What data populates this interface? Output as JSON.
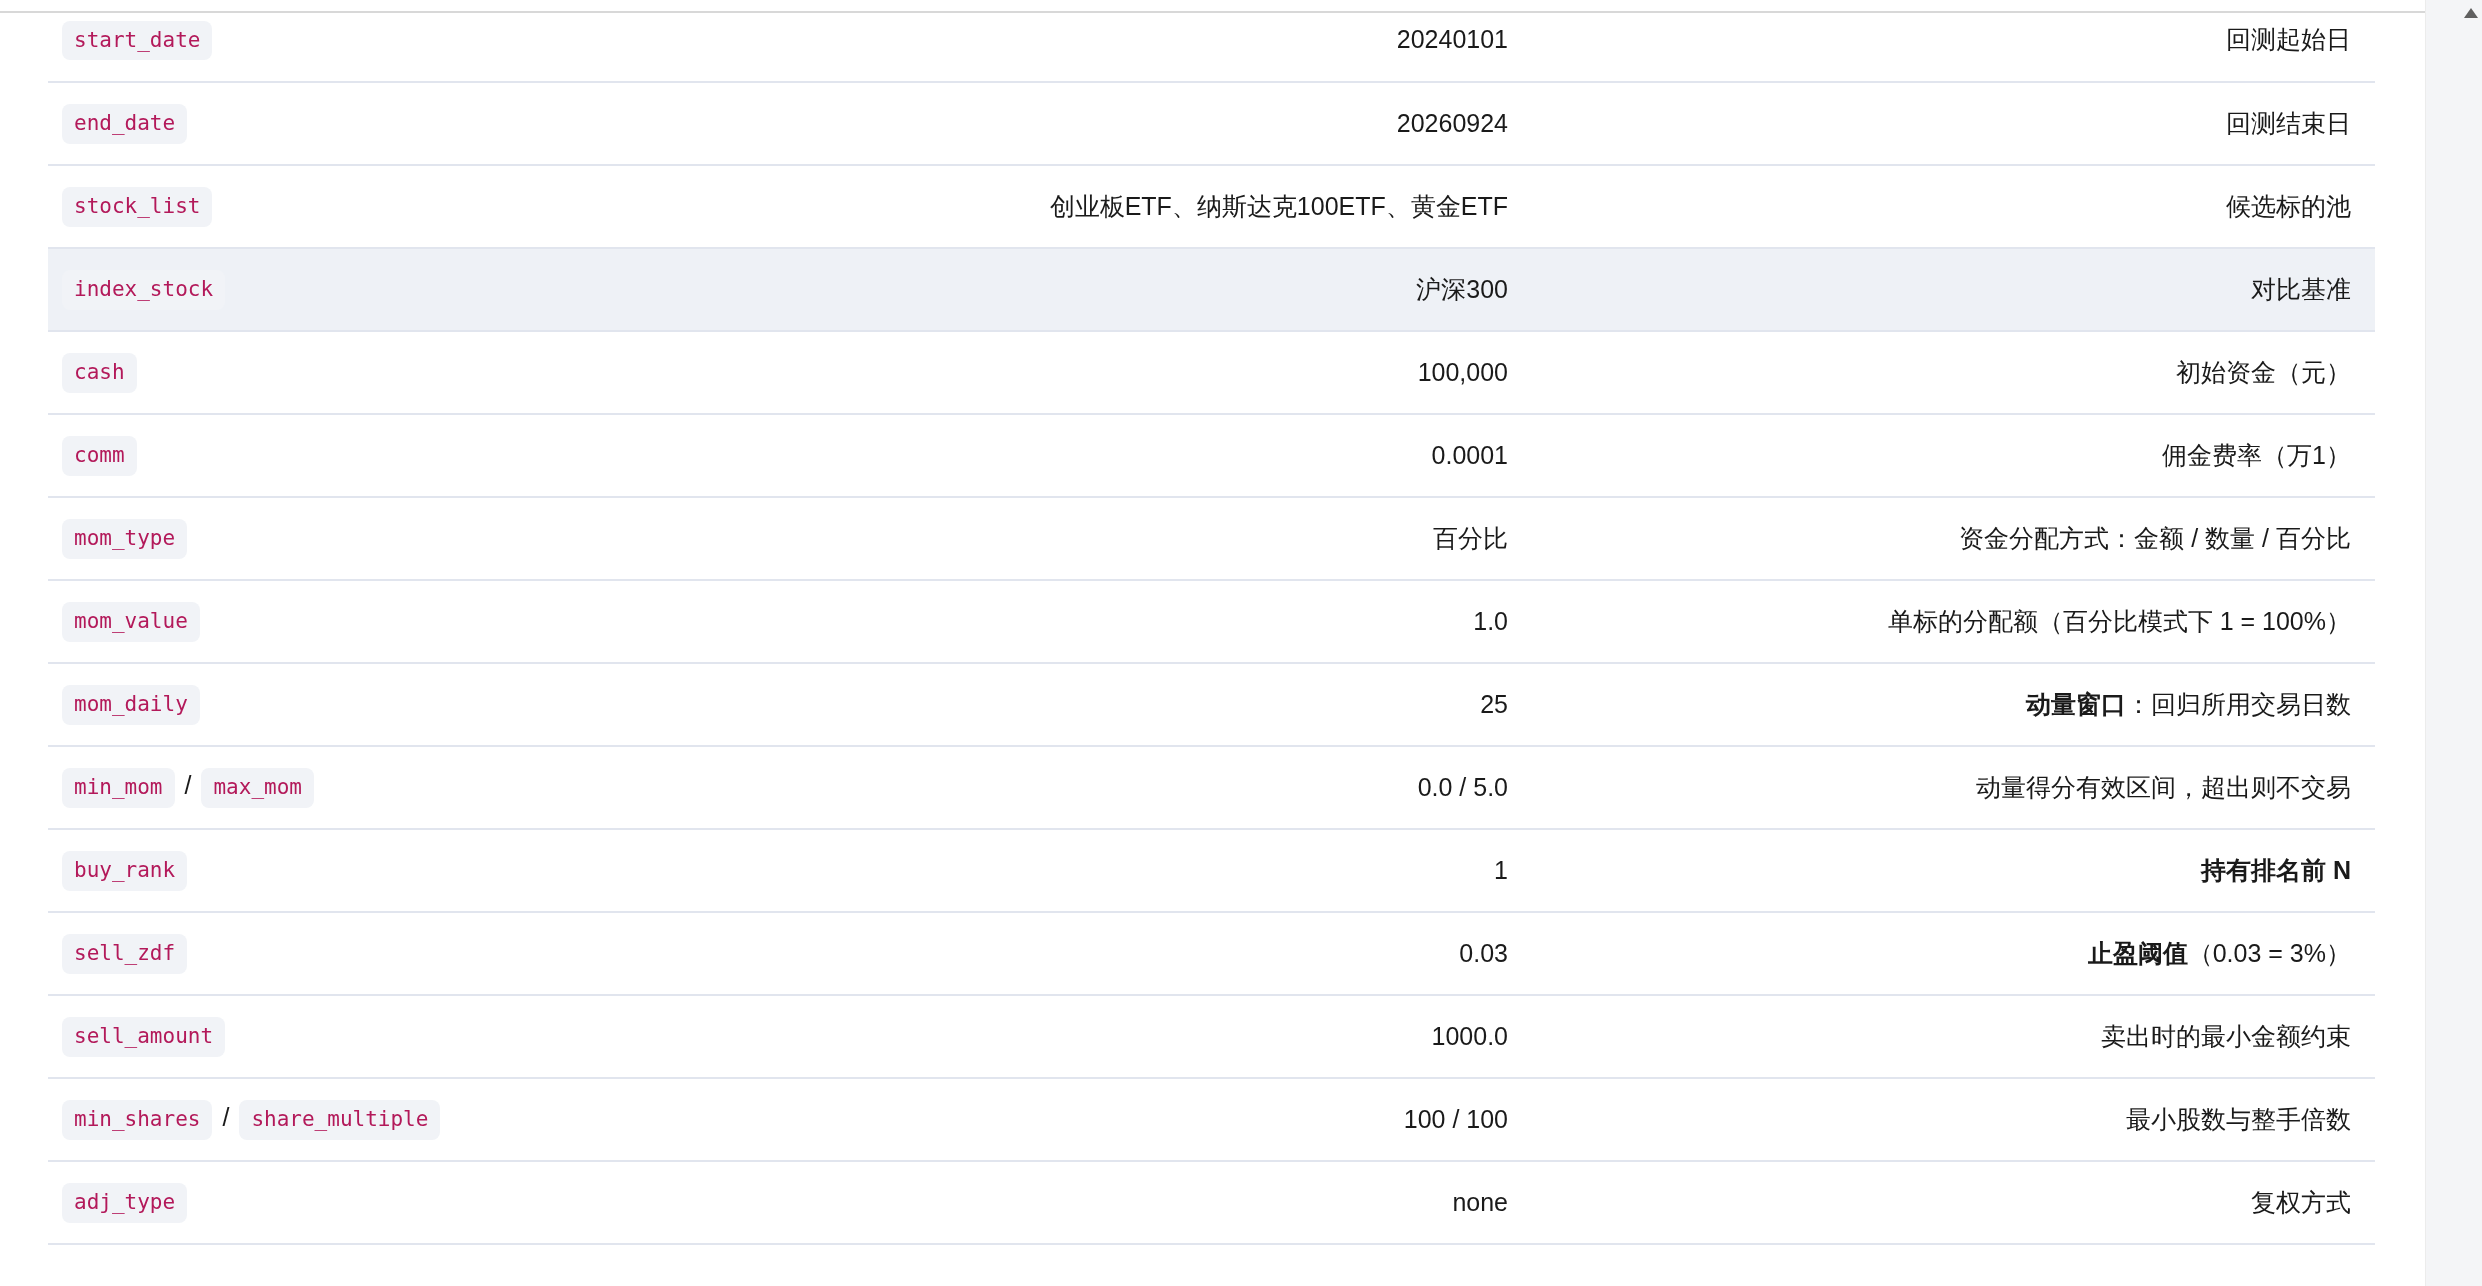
{
  "params": [
    {
      "keys": [
        "start_date"
      ],
      "value": "20240101",
      "description": "回测起始日",
      "highlighted": false
    },
    {
      "keys": [
        "end_date"
      ],
      "value": "20260924",
      "description": "回测结束日",
      "highlighted": false
    },
    {
      "keys": [
        "stock_list"
      ],
      "value": "创业板ETF、纳斯达克100ETF、黄金ETF",
      "description": "候选标的池",
      "highlighted": false
    },
    {
      "keys": [
        "index_stock"
      ],
      "value": "沪深300",
      "description": "对比基准",
      "highlighted": true
    },
    {
      "keys": [
        "cash"
      ],
      "value": "100,000",
      "description": "初始资金（元）",
      "highlighted": false
    },
    {
      "keys": [
        "comm"
      ],
      "value": "0.0001",
      "description": "佣金费率（万1）",
      "highlighted": false
    },
    {
      "keys": [
        "mom_type"
      ],
      "value": "百分比",
      "description": "资金分配方式：金额 / 数量 / 百分比",
      "highlighted": false
    },
    {
      "keys": [
        "mom_value"
      ],
      "value": "1.0",
      "description": "单标的分配额（百分比模式下 1 = 100%）",
      "highlighted": false
    },
    {
      "keys": [
        "mom_daily"
      ],
      "value": "25",
      "description": "**动量窗口**：回归所用交易日数",
      "highlighted": false
    },
    {
      "keys": [
        "min_mom",
        "max_mom"
      ],
      "key_separator": "/",
      "value": "0.0 / 5.0",
      "description": "动量得分有效区间，超出则不交易",
      "highlighted": false
    },
    {
      "keys": [
        "buy_rank"
      ],
      "value": "1",
      "description": "持有排名前 N",
      "description_bold": true,
      "highlighted": false
    },
    {
      "keys": [
        "sell_zdf"
      ],
      "value": "0.03",
      "description": "**止盈阈值**（0.03 = 3%）",
      "highlighted": false
    },
    {
      "keys": [
        "sell_amount"
      ],
      "value": "1000.0",
      "description": "卖出时的最小金额约束",
      "highlighted": false
    },
    {
      "keys": [
        "min_shares",
        "share_multiple"
      ],
      "key_separator": "/",
      "value": "100 / 100",
      "description": "最小股数与整手倍数",
      "highlighted": false
    },
    {
      "keys": [
        "adj_type"
      ],
      "value": "none",
      "description": "复权方式",
      "highlighted": false
    }
  ]
}
